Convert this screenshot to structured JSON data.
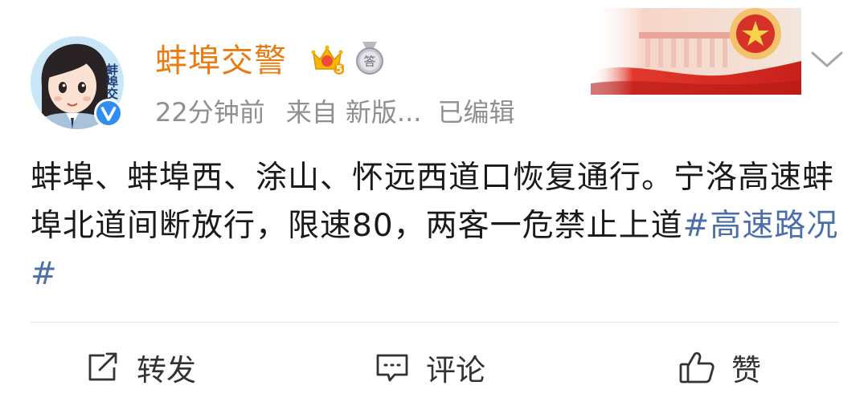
{
  "post": {
    "author": {
      "name": "蚌埠交警",
      "avatar_text": "蚌埠交",
      "vip_level": "5",
      "medal_text": "答",
      "verified": true
    },
    "meta": {
      "time": "22分钟前",
      "source": "来自 新版...",
      "edited": "已编辑"
    },
    "text_main": "蚌埠、蚌埠西、涂山、怀远西道口恢复通行。宁洛高速蚌埠北道间断放行，限速80，两客一危禁止上道",
    "hashtag": "#高速路况#"
  },
  "actions": {
    "repost_label": "转发",
    "comment_label": "评论",
    "like_label": "赞"
  },
  "icons": {
    "verified": "verified-v-icon",
    "vip": "vip-crown-icon",
    "medal": "medal-icon",
    "banner": "national-emblem-banner",
    "more": "chevron-down-icon",
    "repost": "repost-icon",
    "comment": "comment-icon",
    "like": "thumbs-up-icon"
  },
  "colors": {
    "username": "#eb7b10",
    "hashtag": "#4b6fa8",
    "meta": "#8f8f8f",
    "verified": "#2f8ef4"
  }
}
